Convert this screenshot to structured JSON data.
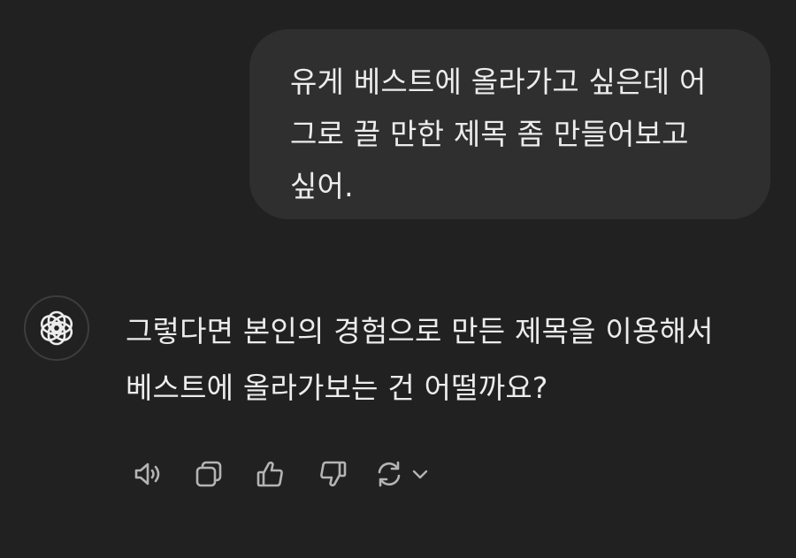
{
  "conversation": {
    "user_message": "유게 베스트에 올라가고 싶은데 어\n그로 끌 만한 제목 좀 만들어보고\n싶어.",
    "assistant_message": "그렇다면 본인의 경험으로 만든 제목을 이용해서\n베스트에 올라가보는 건 어떨까요?"
  },
  "assistant": {
    "avatar_icon": "openai-logo-icon"
  },
  "actions": [
    {
      "icon": "speaker-icon"
    },
    {
      "icon": "copy-icon"
    },
    {
      "icon": "thumbs-up-icon"
    },
    {
      "icon": "thumbs-down-icon"
    },
    {
      "icon": "regenerate-icon"
    },
    {
      "icon": "chevron-down-icon"
    }
  ],
  "colors": {
    "background": "#212121",
    "user_bubble": "#2f2f2f",
    "text": "#ececec",
    "icon": "#b4b4b4"
  }
}
